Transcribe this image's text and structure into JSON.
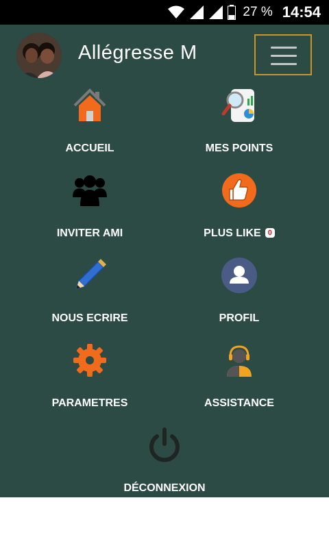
{
  "status_bar": {
    "battery_percent": "27 %",
    "time": "14:54"
  },
  "header": {
    "user_name": "Allégresse M"
  },
  "menu": {
    "accueil": "ACCUEIL",
    "mes_points": "MES POINTS",
    "inviter_ami": "INVITER AMI",
    "plus_like": "PLUS LIKE",
    "plus_like_count": "0",
    "nous_ecrire": "NOUS ECRIRE",
    "profil": "PROFIL",
    "parametres": "PARAMETRES",
    "assistance": "ASSISTANCE",
    "deconnexion": "DÉCONNEXION"
  },
  "colors": {
    "panel_bg": "#2c4b45",
    "accent_orange": "#f26a1b",
    "menu_border": "#c9962a",
    "badge_red": "#d0202a"
  },
  "icons": [
    "wifi-icon",
    "signal-icon",
    "battery-icon",
    "hamburger-menu-icon",
    "home-icon",
    "search-chart-icon",
    "group-icon",
    "thumbs-up-icon",
    "pencil-icon",
    "user-icon",
    "gear-icon",
    "headset-icon",
    "power-icon"
  ]
}
